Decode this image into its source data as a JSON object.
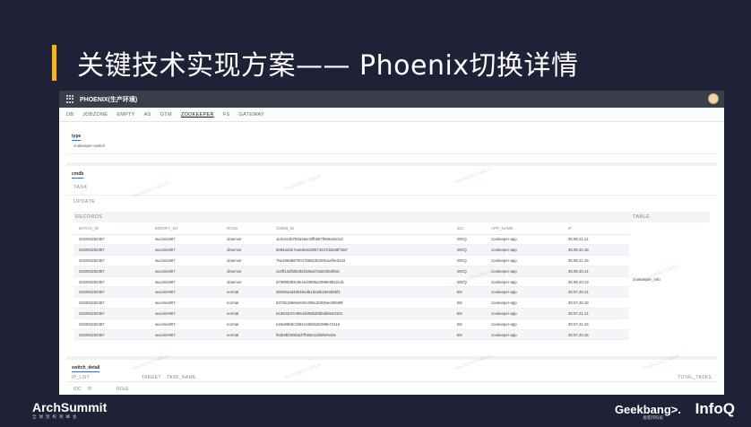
{
  "slide": {
    "title": "关键技术实现方案—— Phoenix切换详情"
  },
  "app": {
    "title": "PHOENIX(生产环境)"
  },
  "tabs": [
    {
      "label": "DB",
      "active": false
    },
    {
      "label": "JOBZONE",
      "active": false
    },
    {
      "label": "EMPTY",
      "active": false
    },
    {
      "label": "AS",
      "active": false
    },
    {
      "label": "GTM",
      "active": false
    },
    {
      "label": "ZOOKEEPER",
      "active": true
    },
    {
      "label": "FS",
      "active": false
    },
    {
      "label": "GATEWAY",
      "active": false
    }
  ],
  "type_section": {
    "label": "type",
    "value": "zookeeper-switch"
  },
  "cmdb_section": {
    "label": "cmdb",
    "task_label": "TASK",
    "update_label": "UPDATE",
    "records_label": "RECORDS",
    "table_label": "TABLE",
    "table_value": "zookeeper_info",
    "columns": [
      "BATCH_ID",
      "MODIFY_BY",
      "ROLE",
      "CMDB_ID",
      "IDC",
      "APP_NAME",
      "IP"
    ],
    "rows": [
      [
        "201903292357",
        "wucimin807",
        "observer",
        "1e4c6c4b783a46ec9ffb957f956e8201d",
        "WGQ",
        "zookeeper-app",
        "30.99.21.14"
      ],
      [
        "201903292357",
        "wucimin807",
        "observer",
        "6084a2de7ea6de6180674227d1849f7a57",
        "WGQ",
        "zookeeper-app",
        "30.99.20.18"
      ],
      [
        "201903292357",
        "wucimin807",
        "observer",
        "76e289d6970047b6823b280caef9cd103",
        "WGQ",
        "zookeeper-app",
        "30.99.21.15"
      ],
      [
        "201903292357",
        "wucimin807",
        "observer",
        "ce0ff132fb5b4bd196a27a0e0394f60c",
        "WGQ",
        "zookeeper-app",
        "30.99.20.14"
      ],
      [
        "201903292357",
        "wucimin807",
        "observer",
        "d76988383c9e4e40895a2998e9b32cdc",
        "WGQ",
        "zookeeper-app",
        "30.99.20.13"
      ],
      [
        "201903292357",
        "wucimin807",
        "normal",
        "39035a4d48549edb1fa3d618e0d56f1",
        "BX",
        "zookeeper-app",
        "30.07.20.14"
      ],
      [
        "201903292357",
        "wucimin807",
        "normal",
        "5373b198ebe945c096c2004bec86599f",
        "BX",
        "zookeeper-app",
        "30.07.20.18"
      ],
      [
        "201903292357",
        "wucimin807",
        "normal",
        "61550207e48544b98bd5bbdd8e83101",
        "BX",
        "zookeeper-app",
        "30.07.21.14"
      ],
      [
        "201903292357",
        "wucimin807",
        "normal",
        "e26a98b8c2b84145b8150288e74116",
        "BX",
        "zookeeper-app",
        "30.07.21.15"
      ],
      [
        "201903292357",
        "wucimin807",
        "normal",
        "f52b9bf269b4d7fb6561d26f6e542e",
        "BX",
        "zookeeper-app",
        "30.07.20.15"
      ]
    ]
  },
  "switch_detail": {
    "label": "switch_detail",
    "ip_list_label": "IP_LIST",
    "target_label": "TARGET",
    "task_name_label": "TASK_NAME",
    "total_tasks_label": "TOTAL_TASKS",
    "idc_label": "IDC",
    "ip_label": "IP",
    "role_label": "ROLE"
  },
  "watermark": "liuyuhui001-190513",
  "footer": {
    "arch_logo": "ArchSummit",
    "arch_sub": "全球架构师峰会",
    "geek_logo": "Geekbang>.",
    "geek_sub": "极客邦科技",
    "infoq_logo": "InfoQ"
  }
}
